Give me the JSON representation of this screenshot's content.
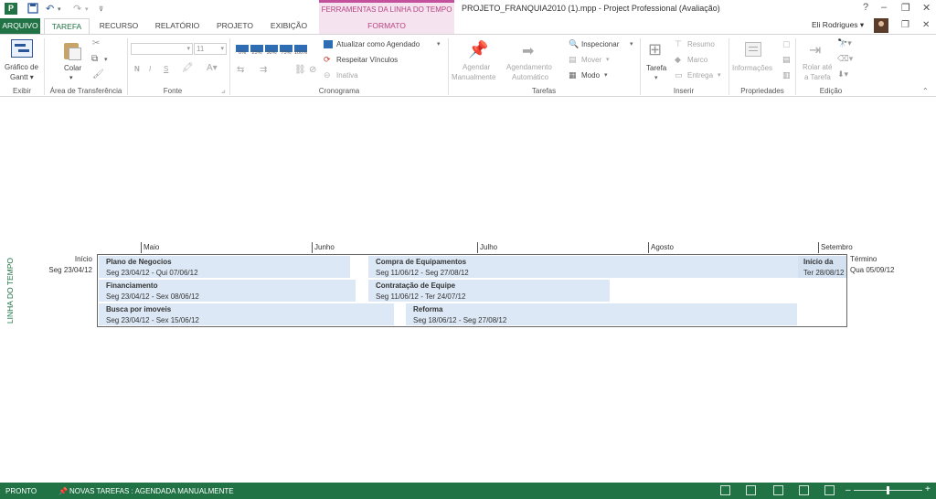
{
  "window": {
    "title": "PROJETO_FRANQUIA2010 (1).mpp - Project Professional (Avaliação)",
    "context_group": "FERRAMENTAS DA LINHA DO TEMPO",
    "help": "?",
    "minimize": "–",
    "restore": "❐",
    "close": "✕",
    "app_icon": "P"
  },
  "tabs": [
    "ARQUIVO",
    "TAREFA",
    "RECURSO",
    "RELATÓRIO",
    "PROJETO",
    "EXIBIÇÃO",
    "FORMATO"
  ],
  "user": {
    "name": "Eli Rodrigues ▾"
  },
  "ribbon": {
    "view": {
      "btn": "Gráfico de Gantt ▾",
      "line1": "Gráfico de",
      "line2": "Gantt ▾",
      "group": "Exibir"
    },
    "clipboard": {
      "paste": "Colar",
      "paste_arrow": "▾",
      "group": "Área de Transferência"
    },
    "font": {
      "size": "11",
      "bold": "N",
      "italic": "I",
      "underline": "S",
      "group": "Fonte"
    },
    "schedule": {
      "pcts": [
        "0%",
        "25%",
        "50%",
        "75%",
        "100%"
      ],
      "update": "Atualizar como Agendado",
      "respect": "Respeitar Vínculos",
      "inactive": "Inativa",
      "group": "Cronograma"
    },
    "tasks": {
      "manual1": "Agendar",
      "manual2": "Manualmente",
      "auto1": "Agendamento",
      "auto2": "Automático",
      "inspect": "Inspecionar",
      "move": "Mover",
      "mode": "Modo",
      "group": "Tarefas"
    },
    "insert": {
      "task": "Tarefa",
      "summary": "Resumo",
      "milestone": "Marco",
      "deliverable": "Entrega",
      "group": "Inserir"
    },
    "properties": {
      "info": "Informações",
      "group": "Propriedades"
    },
    "editing": {
      "scroll1": "Rolar até",
      "scroll2": "a Tarefa",
      "group": "Edição"
    }
  },
  "timeline": {
    "side_label": "LINHA DO TEMPO",
    "start_label": "Início",
    "start_date": "Seg 23/04/12",
    "end_label": "Término",
    "end_date": "Qua 05/09/12",
    "months": [
      "Maio",
      "Junho",
      "Julho",
      "Agosto",
      "Setembro"
    ],
    "bars": [
      {
        "name": "Plano de Negocios",
        "dates": "Seg 23/04/12 - Qui 07/06/12"
      },
      {
        "name": "Compra de Equipamentos",
        "dates": "Seg 11/06/12 - Seg 27/08/12"
      },
      {
        "name": "Início da",
        "dates": "Ter 28/08/12"
      },
      {
        "name": "Financiamento",
        "dates": "Seg 23/04/12 - Sex 08/06/12"
      },
      {
        "name": "Contratação de Equipe",
        "dates": "Seg 11/06/12 - Ter 24/07/12"
      },
      {
        "name": "Busca por imoveis",
        "dates": "Seg 23/04/12 - Sex 15/06/12"
      },
      {
        "name": "Reforma",
        "dates": "Seg 18/06/12 - Seg 27/08/12"
      }
    ]
  },
  "status": {
    "ready": "PRONTO",
    "new_tasks": "NOVAS TAREFAS : AGENDADA MANUALMENTE"
  },
  "colors": {
    "accent": "#217346",
    "context": "#c4519c",
    "bar": "#dce8f5"
  }
}
